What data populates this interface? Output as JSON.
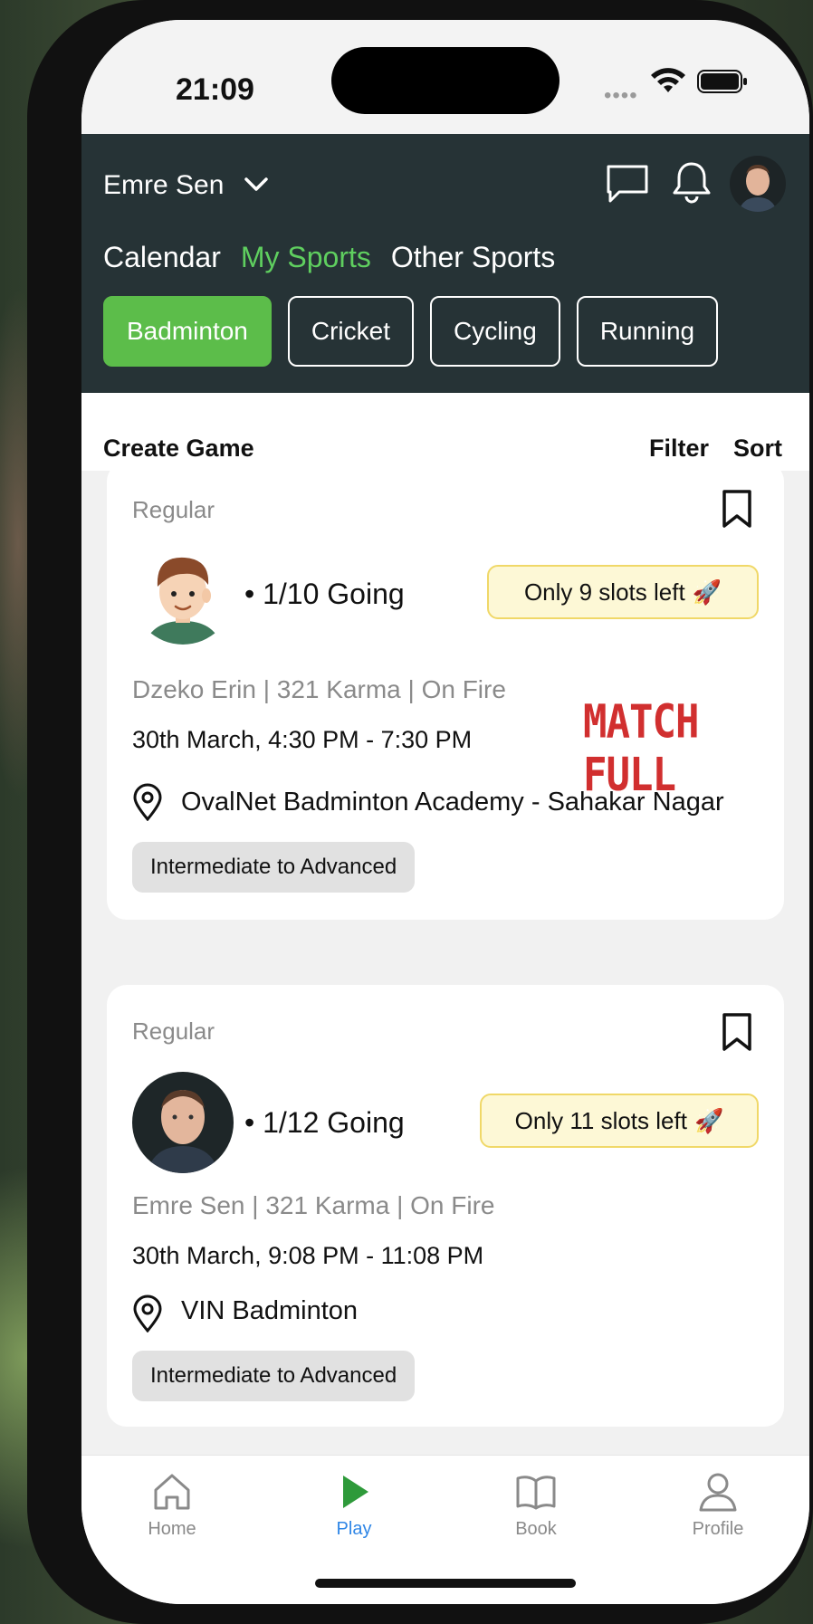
{
  "status_bar": {
    "time": "21:09"
  },
  "header": {
    "user_name": "Emre Sen",
    "tabs": [
      {
        "label": "Calendar",
        "active": false
      },
      {
        "label": "My Sports",
        "active": true
      },
      {
        "label": "Other Sports",
        "active": false
      }
    ],
    "sports": [
      {
        "label": "Badminton",
        "active": true
      },
      {
        "label": "Cricket",
        "active": false
      },
      {
        "label": "Cycling",
        "active": false
      },
      {
        "label": "Running",
        "active": false
      }
    ]
  },
  "actions": {
    "create_game": "Create Game",
    "filter": "Filter",
    "sort": "Sort"
  },
  "games": [
    {
      "type": "Regular",
      "going": "• 1/10 Going",
      "slots": "Only 9 slots left",
      "host_line": "Dzeko Erin | 321 Karma | On Fire",
      "datetime": "30th March, 4:30 PM - 7:30 PM",
      "venue": "OvalNet Badminton Academy - Sahakar Nagar",
      "level": "Intermediate to Advanced",
      "stamp": "MATCH FULL"
    },
    {
      "type": "Regular",
      "going": "• 1/12 Going",
      "slots": "Only 11 slots left",
      "host_line": "Emre Sen | 321 Karma | On Fire",
      "datetime": "30th March, 9:08 PM - 11:08 PM",
      "venue": "VIN Badminton",
      "level": "Intermediate to Advanced"
    }
  ],
  "bottom_nav": [
    {
      "label": "Home",
      "icon": "home-icon",
      "active": false
    },
    {
      "label": "Play",
      "icon": "play-icon",
      "active": true
    },
    {
      "label": "Book",
      "icon": "book-icon",
      "active": false
    },
    {
      "label": "Profile",
      "icon": "profile-icon",
      "active": false
    }
  ],
  "colors": {
    "header_bg": "#263336",
    "accent_green": "#5cbd4a",
    "active_tab": "#5fcf5f",
    "nav_active": "#2f86e6"
  }
}
